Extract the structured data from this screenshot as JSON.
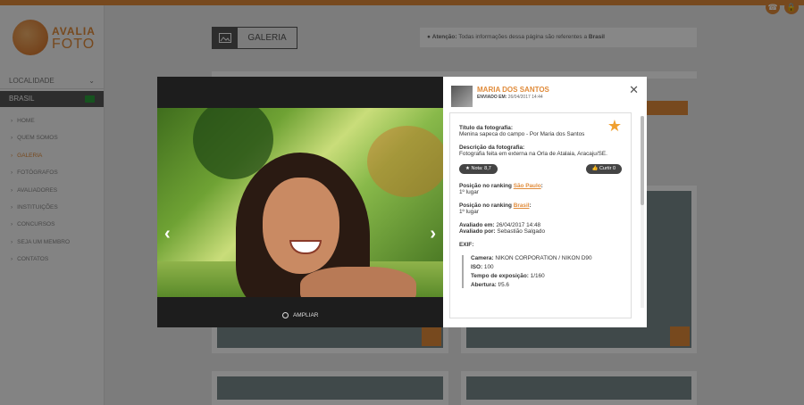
{
  "site": {
    "logo_line1": "AVALIA",
    "logo_line2": "FOTO",
    "top_icons": [
      "phone-icon",
      "lock-icon"
    ]
  },
  "sidebar": {
    "location_label": "LOCALIDADE",
    "selected_country": "BRASIL",
    "items": [
      {
        "label": "HOME",
        "active": false
      },
      {
        "label": "QUEM SOMOS",
        "active": false
      },
      {
        "label": "GALERIA",
        "active": true
      },
      {
        "label": "FOTÓGRAFOS",
        "active": false
      },
      {
        "label": "AVALIADORES",
        "active": false
      },
      {
        "label": "INSTITUIÇÕES",
        "active": false
      },
      {
        "label": "CONCURSOS",
        "active": false
      },
      {
        "label": "SEJA UM MEMBRO",
        "active": false
      },
      {
        "label": "CONTATOS",
        "active": false
      }
    ]
  },
  "header": {
    "gallery_label": "GALERIA",
    "notice_bold": "Atenção:",
    "notice_text": "Todas informações dessa página são referentes a",
    "notice_country": "Brasil"
  },
  "viewer": {
    "zoom_label": "AMPLIAR"
  },
  "details": {
    "user_name": "MARIA DOS SANTOS",
    "sent_label": "ENVIADO EM:",
    "sent_date": "26/04/2017 14:44",
    "title_label": "Título da fotografia:",
    "title_value": "Menina sapeca do campo - Por Maria dos Santos",
    "desc_label": "Descrição da fotografia:",
    "desc_value": "Fotografia feita em externa na Orla de Atalaia, Aracaju/SE.",
    "nota_label": "Nota: 8,7",
    "curtir_label": "Curtir",
    "curtir_count": "0",
    "ranking_label": "Posição no ranking",
    "ranking_city": "São Paulo",
    "ranking_city_value": "1º lugar",
    "ranking_country": "Brasil",
    "ranking_country_value": "1º lugar",
    "evaluated_at_label": "Avaliado em:",
    "evaluated_at": "26/04/2017 14:48",
    "evaluated_by_label": "Avaliado por:",
    "evaluated_by": "Sebastião Salgado",
    "exif_label": "EXIF:",
    "exif": [
      {
        "k": "Camera:",
        "v": "NIKON CORPORATION / NIKON D90"
      },
      {
        "k": "ISO:",
        "v": "100"
      },
      {
        "k": "Tempo de exposição:",
        "v": "1/160"
      },
      {
        "k": "Abertura:",
        "v": "f/5.6"
      }
    ]
  }
}
